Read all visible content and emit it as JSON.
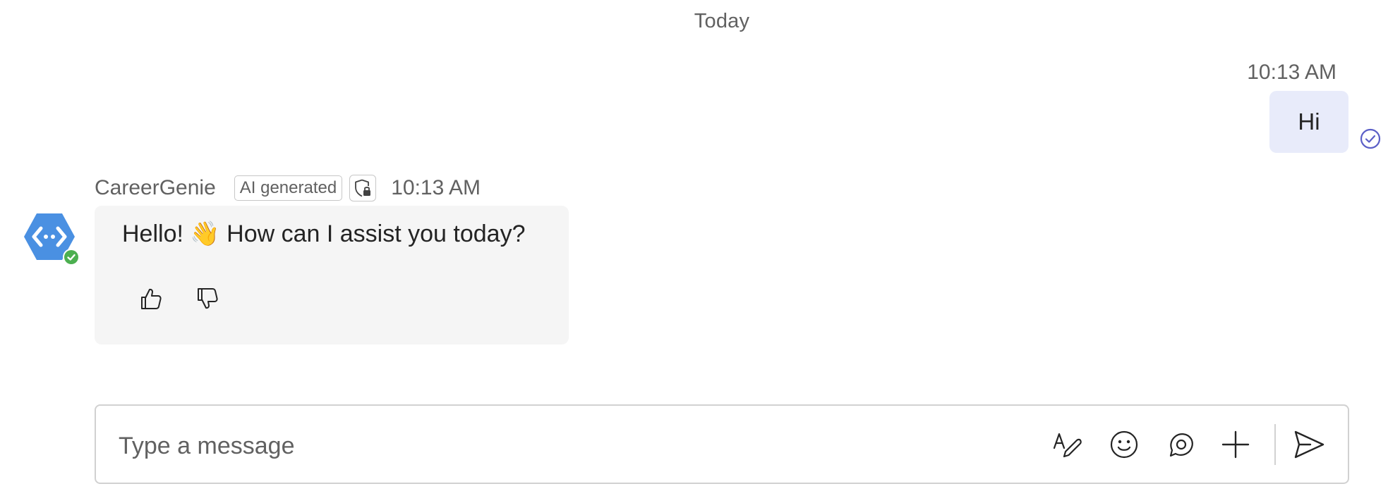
{
  "chat": {
    "day_divider": "Today",
    "outgoing": {
      "time": "10:13 AM",
      "text": "Hi",
      "status_icon": "read-receipt-check-icon"
    },
    "bot": {
      "name": "CareerGenie",
      "badge": "AI generated",
      "badge_icon": "shield-lock-icon",
      "time": "10:13 AM",
      "message": "Hello! 👋 How can I assist you today?",
      "avatar_icon": "code-brackets-hexagon-icon",
      "presence": "available",
      "feedback": [
        "thumbs-up-icon",
        "thumbs-down-icon"
      ]
    }
  },
  "composer": {
    "placeholder": "Type a message",
    "tools": [
      "format-icon",
      "emoji-icon",
      "loop-component-icon",
      "attach-plus-icon"
    ],
    "send_icon": "send-icon"
  },
  "colors": {
    "accent": "#5b5fc7",
    "outgoing_bubble": "#e8ebfa",
    "incoming_bubble": "#f5f5f5",
    "avatar": "#4a90e2",
    "presence_available": "#4caf50"
  }
}
